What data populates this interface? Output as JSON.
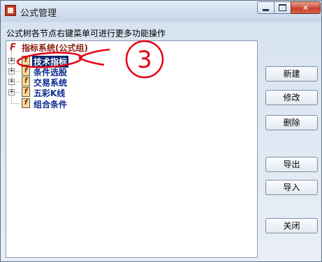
{
  "window": {
    "title": "公式管理",
    "icon": "formula-manager-icon",
    "close_label": "✕"
  },
  "hint": "公式树各节点右键菜单可进行更多功能操作",
  "tree": {
    "root": {
      "label": "指标系统(公式组)",
      "icon": "formula-group-icon"
    },
    "items": [
      {
        "label": "技术指标",
        "selected": true,
        "expander": "+"
      },
      {
        "label": "条件选股",
        "expander": "+"
      },
      {
        "label": "交易系统",
        "expander": "+"
      },
      {
        "label": "五彩K线",
        "expander": "+"
      },
      {
        "label": "组合条件",
        "expander": ""
      }
    ],
    "icon_glyph": "f"
  },
  "annotation": {
    "number": "3",
    "color": "#e60012"
  },
  "buttons": {
    "new": "新建",
    "edit": "修改",
    "delete": "删除",
    "export": "导出",
    "import": "导入",
    "close": "关闭"
  },
  "colors": {
    "selection": "#0a246a",
    "close_button": "#c8432d"
  }
}
